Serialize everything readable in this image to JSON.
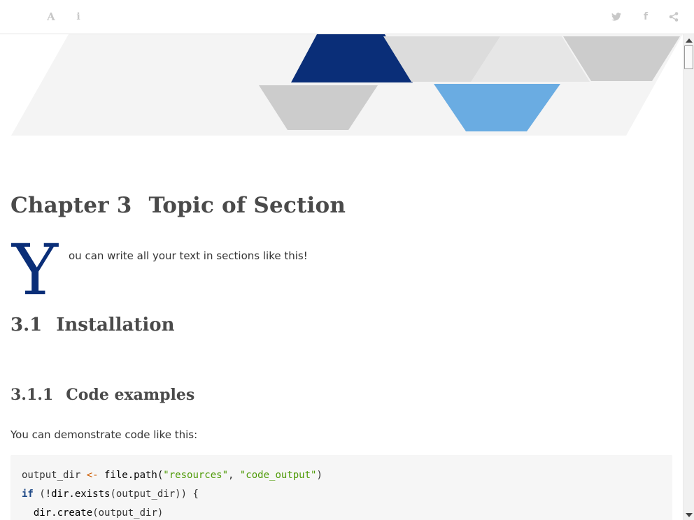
{
  "toolbar": {
    "font_icon": "A",
    "info_icon": "i",
    "twitter_icon": "twitter-icon",
    "facebook_icon": "f",
    "share_icon": "share-icon"
  },
  "colors": {
    "accent_dark": "#0a2e78",
    "accent_light": "#6aace2",
    "banner_gray": "#cccccc",
    "banner_bg": "#f4f4f4"
  },
  "chapter": {
    "number": "Chapter 3",
    "title": "Topic of Section",
    "dropcap": "Y",
    "intro": "ou can write all your text in sections like this!"
  },
  "section": {
    "number": "3.1",
    "title": "Installation"
  },
  "subsection": {
    "number": "3.1.1",
    "title": "Code examples",
    "text": "You can demonstrate code like this:"
  },
  "code": {
    "line1": {
      "a": "output_dir ",
      "op": "<-",
      "b": " file.path(",
      "s1": "\"resources\"",
      "c": ", ",
      "s2": "\"code_output\"",
      "d": ")"
    },
    "line2": {
      "kw": "if",
      "a": " (",
      "fn": "!dir.exists",
      "b": "(output_dir)) {"
    },
    "line3": {
      "fn": "  dir.create",
      "a": "(output_dir)"
    }
  }
}
